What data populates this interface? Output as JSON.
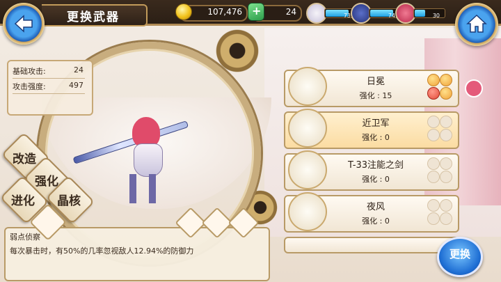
{
  "header": {
    "title": "更换武器",
    "gold": "107,476",
    "gems": "24",
    "team": [
      {
        "name": "member-1",
        "value": "73",
        "level": 0.75
      },
      {
        "name": "member-2",
        "value": "74",
        "level": 0.76
      },
      {
        "name": "member-3",
        "value": "30",
        "level": 0.35
      }
    ],
    "icons": {
      "back": "back-arrow-icon",
      "home": "home-icon",
      "gold": "gold-coin-icon",
      "gem": "gem-plus-icon"
    }
  },
  "stats": {
    "base_attack_label": "基础攻击:",
    "base_attack_value": "24",
    "attack_strength_label": "攻击强度:",
    "attack_strength_value": "497"
  },
  "actions": {
    "modify": "改造",
    "enhance": "强化",
    "evolve": "进化",
    "crystal": "晶核"
  },
  "skill": {
    "name": "弱点侦察",
    "description": "每次暴击时，有50%的几率忽视敌人12.94%的防御力"
  },
  "weapons": [
    {
      "name": "日冕",
      "enhance": "强化 : 15",
      "stars": 3,
      "selected": false,
      "equipped": true
    },
    {
      "name": "近卫军",
      "enhance": "强化 : 0",
      "stars": 3,
      "selected": true,
      "equipped": false
    },
    {
      "name": "T-33注能之剑",
      "enhance": "强化 : 0",
      "stars": 3,
      "selected": false,
      "equipped": false
    },
    {
      "name": "夜风",
      "enhance": "强化 : 0",
      "stars": 3,
      "selected": false,
      "equipped": false
    }
  ],
  "confirm": {
    "label": "更换"
  },
  "colors": {
    "accent": "#1f6fd4",
    "frame": "#b89a66",
    "selected_card": "#fbdca2"
  }
}
